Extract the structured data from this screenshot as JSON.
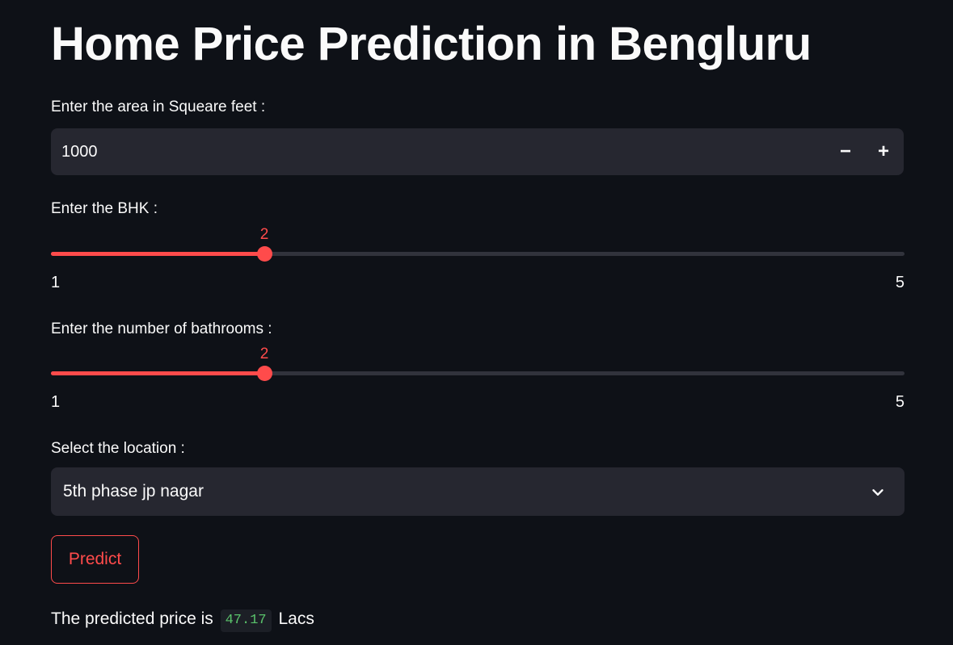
{
  "page": {
    "title": "Home Price Prediction in Bengluru"
  },
  "area": {
    "label": "Enter the area in Squeare feet :",
    "value": "1000",
    "minus_label": "−",
    "plus_label": "+"
  },
  "bhk": {
    "label": "Enter the BHK :",
    "value": 2,
    "min": 1,
    "max": 5
  },
  "bathrooms": {
    "label": "Enter the number of bathrooms :",
    "value": 2,
    "min": 1,
    "max": 5
  },
  "location": {
    "label": "Select the location :",
    "selected": "5th phase jp nagar",
    "icon": "chevron-down-icon"
  },
  "predict": {
    "button_label": "Predict"
  },
  "result": {
    "prefix": "The predicted price is",
    "value": "47.17",
    "suffix": "Lacs"
  },
  "colors": {
    "background": "#0e1117",
    "accent": "#ff4b4b",
    "input_bg": "#262730",
    "result_value": "#5ac36b"
  }
}
